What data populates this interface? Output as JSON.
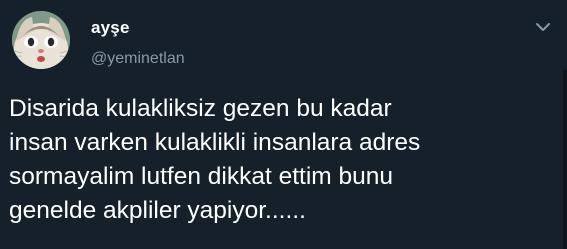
{
  "tweet": {
    "author": {
      "display_name": "ayşe",
      "handle": "@yeminetlan"
    },
    "text_lines": [
      "Disarida kulakliksiz gezen bu kadar",
      "insan varken kulaklikli insanlara adres",
      "sormayalim lutfen dikkat ettim bunu",
      "genelde akpliler yapiyor......"
    ],
    "menu_icon": "chevron-down-icon",
    "avatar_icon": "cat-face-avatar"
  },
  "colors": {
    "background": "#15202b",
    "primary_text": "#ffffff",
    "secondary_text": "#8899a6"
  }
}
